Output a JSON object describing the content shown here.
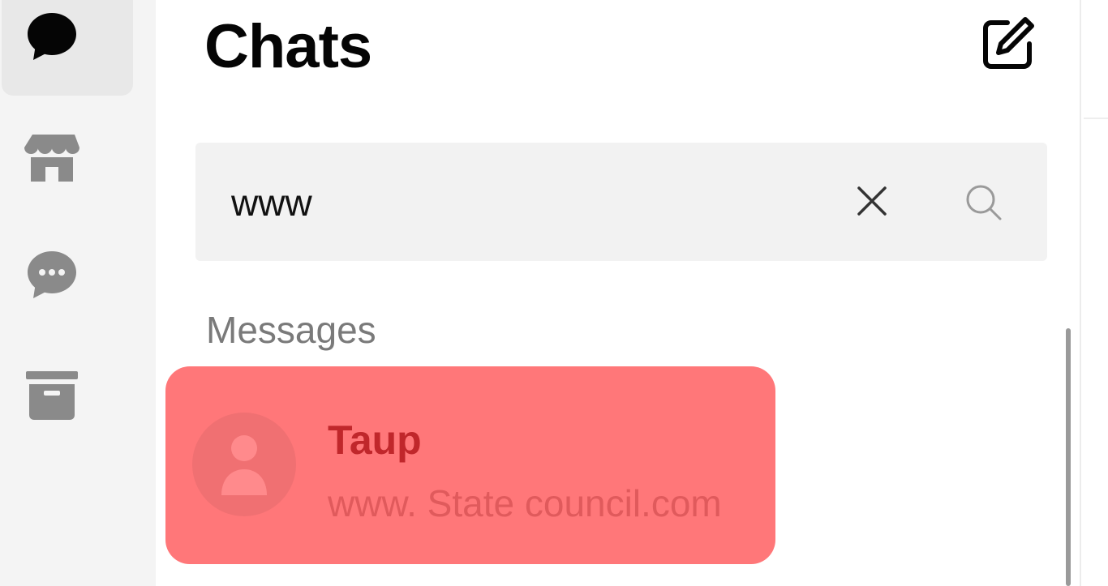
{
  "sidebar": {
    "items": [
      {
        "icon": "chat-bubble-icon",
        "active": true
      },
      {
        "icon": "marketplace-store-icon",
        "active": false
      },
      {
        "icon": "message-requests-icon",
        "active": false
      },
      {
        "icon": "archive-box-icon",
        "active": false
      }
    ]
  },
  "header": {
    "title": "Chats",
    "compose_icon": "new-message-icon"
  },
  "search": {
    "value": "www",
    "clear_icon": "close-icon",
    "search_icon": "search-icon"
  },
  "results": {
    "section_label": "Messages",
    "items": [
      {
        "name": "Taup",
        "snippet": "www. State council.com",
        "avatar_icon": "default-avatar-icon"
      }
    ]
  },
  "colors": {
    "highlight": "#ff7779",
    "rail_background": "#f4f4f4",
    "search_background": "#f2f2f2"
  }
}
